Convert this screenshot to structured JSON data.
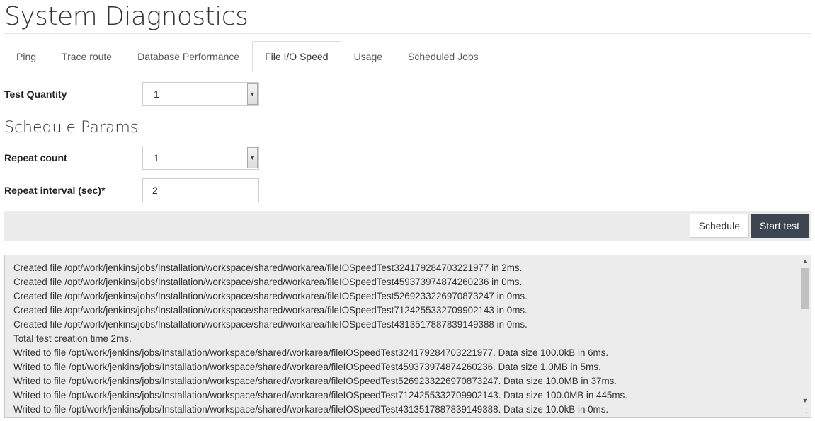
{
  "page": {
    "title": "System Diagnostics"
  },
  "tabs": [
    {
      "label": "Ping",
      "active": false
    },
    {
      "label": "Trace route",
      "active": false
    },
    {
      "label": "Database Performance",
      "active": false
    },
    {
      "label": "File I/O Speed",
      "active": true
    },
    {
      "label": "Usage",
      "active": false
    },
    {
      "label": "Scheduled Jobs",
      "active": false
    }
  ],
  "form": {
    "test_quantity_label": "Test Quantity",
    "test_quantity_value": "1",
    "schedule_title": "Schedule Params",
    "repeat_count_label": "Repeat count",
    "repeat_count_value": "1",
    "repeat_interval_label": "Repeat interval (sec)*",
    "repeat_interval_value": "2"
  },
  "actions": {
    "schedule_label": "Schedule",
    "start_label": "Start test"
  },
  "log": {
    "lines": [
      "Created file /opt/work/jenkins/jobs/Installation/workspace/shared/workarea/fileIOSpeedTest324179284703221977 in 2ms.",
      "Created file /opt/work/jenkins/jobs/Installation/workspace/shared/workarea/fileIOSpeedTest459373974874260236 in 0ms.",
      "Created file /opt/work/jenkins/jobs/Installation/workspace/shared/workarea/fileIOSpeedTest5269233226970873247 in 0ms.",
      "Created file /opt/work/jenkins/jobs/Installation/workspace/shared/workarea/fileIOSpeedTest7124255332709902143 in 0ms.",
      "Created file /opt/work/jenkins/jobs/Installation/workspace/shared/workarea/fileIOSpeedTest4313517887839149388 in 0ms.",
      "Total test creation time 2ms.",
      "Writed to file /opt/work/jenkins/jobs/Installation/workspace/shared/workarea/fileIOSpeedTest324179284703221977. Data size 100.0kB in 6ms.",
      "Writed to file /opt/work/jenkins/jobs/Installation/workspace/shared/workarea/fileIOSpeedTest459373974874260236. Data size 1.0MB in 5ms.",
      "Writed to file /opt/work/jenkins/jobs/Installation/workspace/shared/workarea/fileIOSpeedTest5269233226970873247. Data size 10.0MB in 37ms.",
      "Writed to file /opt/work/jenkins/jobs/Installation/workspace/shared/workarea/fileIOSpeedTest7124255332709902143. Data size 100.0MB in 445ms.",
      "Writed to file /opt/work/jenkins/jobs/Installation/workspace/shared/workarea/fileIOSpeedTest4313517887839149388. Data size 10.0kB in 0ms."
    ]
  },
  "icons": {
    "select_arrow": "chevron-down-icon",
    "scroll_up": "arrow-up-icon",
    "scroll_down": "arrow-down-icon",
    "resize": "resize-grip-icon"
  },
  "colors": {
    "start_button_bg": "#3d4650",
    "action_bar_bg": "#ebebeb",
    "log_bg": "#ececec"
  }
}
